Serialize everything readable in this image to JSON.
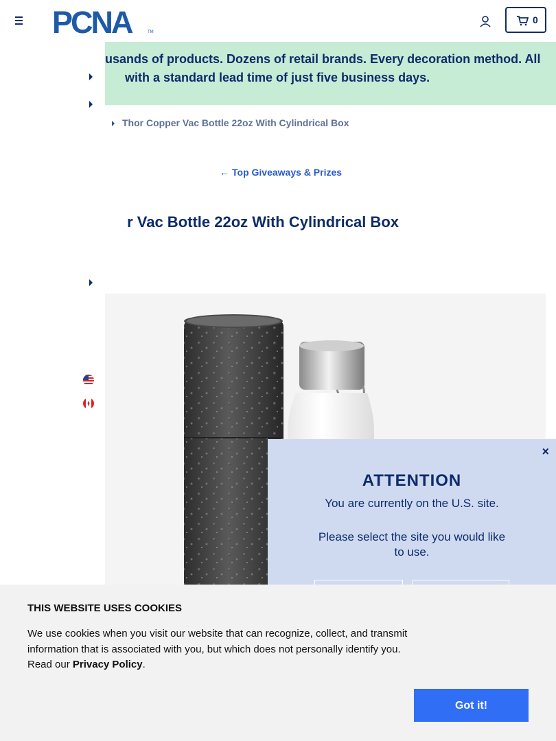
{
  "header": {
    "logo_text": "PCNA",
    "cart_count": "0"
  },
  "promo": {
    "line1": "usands of products. Dozens of retail brands. Every decoration method. All",
    "line2": "with a standard lead time of just five business days."
  },
  "breadcrumb": {
    "current": "Thor Copper Vac Bottle 22oz With Cylindrical Box"
  },
  "back_link": {
    "arrow": "←",
    "label": "Top Giveaways & Prizes"
  },
  "product": {
    "title": "r Vac Bottle 22oz With Cylindrical Box"
  },
  "sidebar": {
    "flags": [
      "us-flag-icon",
      "canada-flag-icon"
    ]
  },
  "modal": {
    "close": "×",
    "title": "ATTENTION",
    "text1": "You are currently on the U.S. site.",
    "text2": "Please select the site you would like to use."
  },
  "cookie": {
    "title": "THIS WEBSITE USES COOKIES",
    "text_before": "We use cookies when you visit our website that can recognize, collect, and transmit information that is associated with you, but which does not personally identify you. Read our ",
    "link": "Privacy Policy",
    "text_after": ".",
    "button": "Got it!"
  },
  "colors": {
    "brand_navy": "#0d2b6b",
    "promo_bg": "#c7ecd5",
    "modal_bg": "#cfdaf0",
    "button_blue": "#2f6ef5"
  }
}
